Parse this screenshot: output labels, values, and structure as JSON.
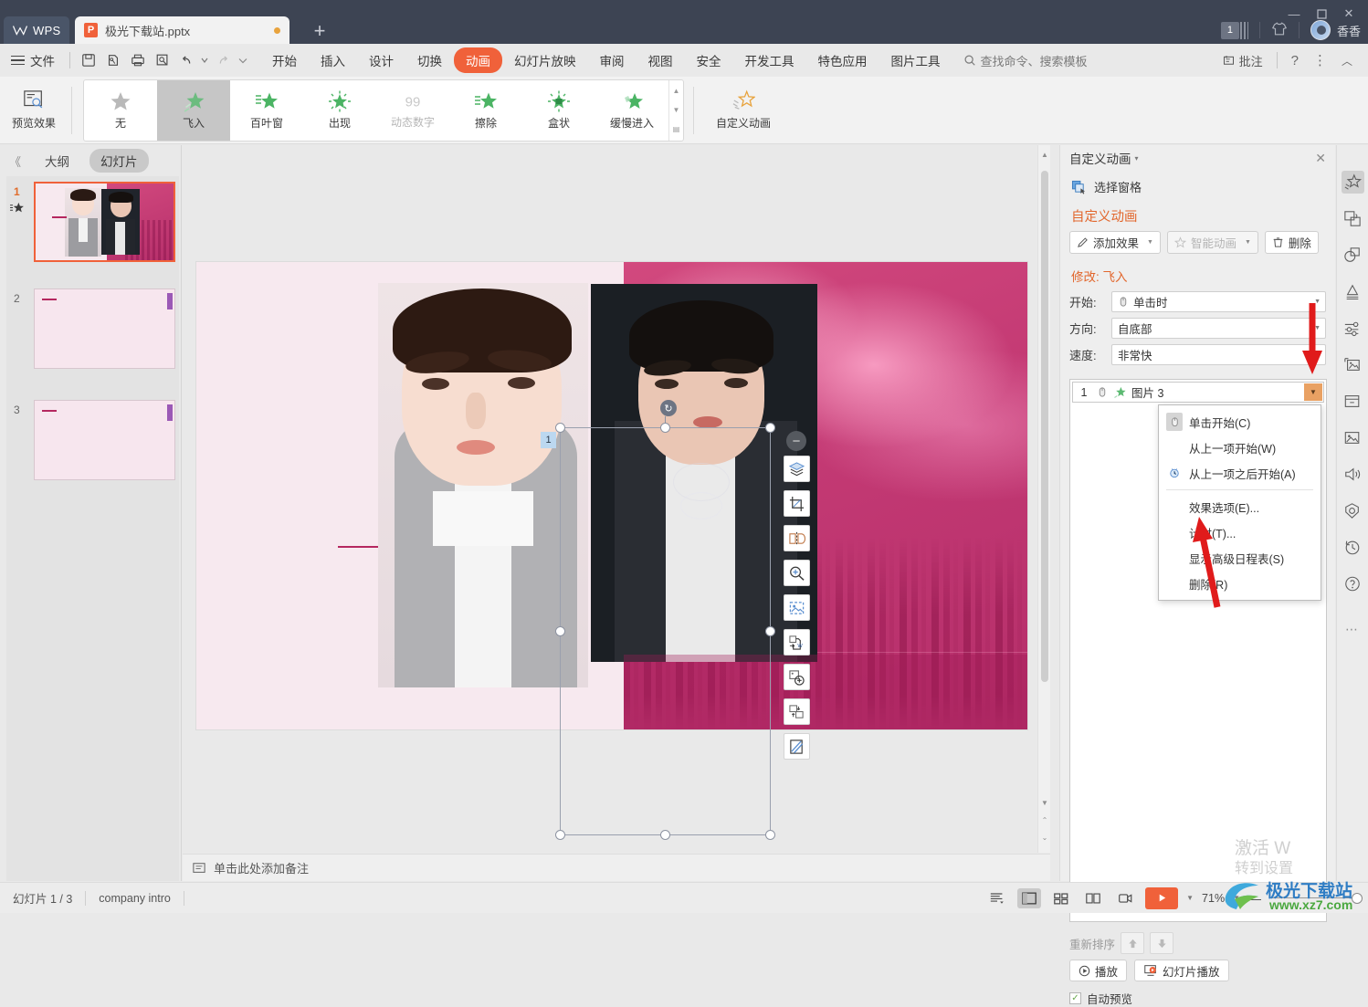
{
  "titlebar": {
    "app_name": "WPS",
    "doc_tab": "极光下载站.pptx",
    "new_tab": "+",
    "page_badge": "1",
    "user_name": "香香",
    "min": "—",
    "max": "▢",
    "close": "✕"
  },
  "menubar": {
    "file": "文件",
    "quick": [
      "save-icon",
      "save-as-icon",
      "print-icon",
      "print-preview-icon",
      "undo-icon",
      "redo-icon",
      "more-icon"
    ],
    "tabs": [
      {
        "label": "开始",
        "active": false
      },
      {
        "label": "插入",
        "active": false
      },
      {
        "label": "设计",
        "active": false
      },
      {
        "label": "切换",
        "active": false
      },
      {
        "label": "动画",
        "active": true
      },
      {
        "label": "幻灯片放映",
        "active": false
      },
      {
        "label": "审阅",
        "active": false
      },
      {
        "label": "视图",
        "active": false
      },
      {
        "label": "安全",
        "active": false
      },
      {
        "label": "开发工具",
        "active": false
      },
      {
        "label": "特色应用",
        "active": false
      },
      {
        "label": "图片工具",
        "active": false
      }
    ],
    "search": "查找命令、搜索模板",
    "comment": "批注",
    "help": "?",
    "more": "⋮",
    "collapse": "︿"
  },
  "ribbon": {
    "preview_label": "预览效果",
    "effects": [
      {
        "label": "无",
        "state": "normal",
        "icon": "star-plain"
      },
      {
        "label": "飞入",
        "state": "selected",
        "icon": "star-fly"
      },
      {
        "label": "百叶窗",
        "state": "normal",
        "icon": "star-blinds"
      },
      {
        "label": "出现",
        "state": "normal",
        "icon": "star-appear"
      },
      {
        "label": "动态数字",
        "state": "disabled",
        "icon": "number-99"
      },
      {
        "label": "擦除",
        "state": "normal",
        "icon": "star-wipe"
      },
      {
        "label": "盒状",
        "state": "normal",
        "icon": "star-box"
      },
      {
        "label": "缓慢进入",
        "state": "normal",
        "icon": "star-slow"
      }
    ],
    "custom_anim_label": "自定义动画"
  },
  "leftpane": {
    "collapse": "《",
    "tabs": [
      {
        "label": "大纲",
        "active": false
      },
      {
        "label": "幻灯片",
        "active": true
      }
    ],
    "slides": [
      {
        "number": "1",
        "selected": true,
        "has_anim_star": true
      },
      {
        "number": "2",
        "selected": false,
        "has_anim_star": false
      },
      {
        "number": "3",
        "selected": false,
        "has_anim_star": false
      }
    ]
  },
  "canvas": {
    "selected_shape_anim_number": "1",
    "rotate_icon": "rotate-handle-icon",
    "float_toolbar": [
      "collapse-toolbar-icon",
      "layer-order-icon",
      "crop-icon",
      "flip-icon",
      "zoom-in-icon",
      "image-select-icon",
      "extract-to-word-icon",
      "add-image-icon",
      "swap-image-icon",
      "image-effects-icon"
    ],
    "notes_placeholder": "单击此处添加备注"
  },
  "pane": {
    "title": "自定义动画",
    "caret": "▾",
    "close": "✕",
    "select_pane": "选择窗格",
    "heading": "自定义动画",
    "add_effect": "添加效果",
    "smart_anim": "智能动画",
    "delete": "删除",
    "modify_label": "修改: 飞入",
    "fields": [
      {
        "label": "开始:",
        "value": "单击时",
        "icon": "mouse-click-icon"
      },
      {
        "label": "方向:",
        "value": "自底部",
        "icon": ""
      },
      {
        "label": "速度:",
        "value": "非常快",
        "icon": ""
      }
    ],
    "list_item": {
      "index": "1",
      "name": "图片 3",
      "mouse_icon": "mouse-click-icon",
      "star_icon": "green-star-icon"
    },
    "context_menu": [
      {
        "label": "单击开始(C)",
        "icon": "mouse-click-icon",
        "selected": true
      },
      {
        "label": "从上一项开始(W)",
        "icon": "",
        "selected": false
      },
      {
        "label": "从上一项之后开始(A)",
        "icon": "clock-icon",
        "selected": false
      },
      {
        "divider": true
      },
      {
        "label": "效果选项(E)...",
        "icon": "",
        "selected": false
      },
      {
        "label": "计时(T)...",
        "icon": "",
        "selected": false
      },
      {
        "label": "显示高级日程表(S)",
        "icon": "",
        "selected": false
      },
      {
        "label": "删除(R)",
        "icon": "",
        "selected": false
      }
    ],
    "reorder_label": "重新排序",
    "reorder_up": "↑",
    "reorder_down": "↓",
    "play": "播放",
    "slideshow": "幻灯片播放",
    "auto_preview": "自动预览",
    "auto_preview_checked": true
  },
  "rail": {
    "icons": [
      {
        "name": "animation-pane-icon",
        "active": true
      },
      {
        "name": "transition-icon",
        "active": false
      },
      {
        "name": "shape-icon",
        "active": false
      },
      {
        "name": "text-art-icon",
        "active": false
      },
      {
        "name": "adjust-sliders-icon",
        "active": false
      },
      {
        "name": "image-library-icon",
        "active": false
      },
      {
        "name": "archive-icon",
        "active": false
      },
      {
        "name": "picture-icon",
        "active": false
      },
      {
        "name": "audio-icon",
        "active": false
      },
      {
        "name": "security-icon",
        "active": false
      },
      {
        "name": "history-icon",
        "active": false
      },
      {
        "name": "help-icon",
        "active": false
      }
    ]
  },
  "status": {
    "slide_count": "幻灯片 1 / 3",
    "section": "company intro",
    "view_icons": [
      "list-view-icon",
      "normal-view-icon",
      "slide-sorter-icon",
      "reading-view-icon",
      "presenter-icon"
    ],
    "play_button": "play-icon",
    "zoom": "71%",
    "zoom_minus": "—"
  },
  "watermark": {
    "activate_line1": "激活 W",
    "activate_line2": "转到设置",
    "site_name": "极光下载站",
    "site_url": "www.xz7.com"
  }
}
